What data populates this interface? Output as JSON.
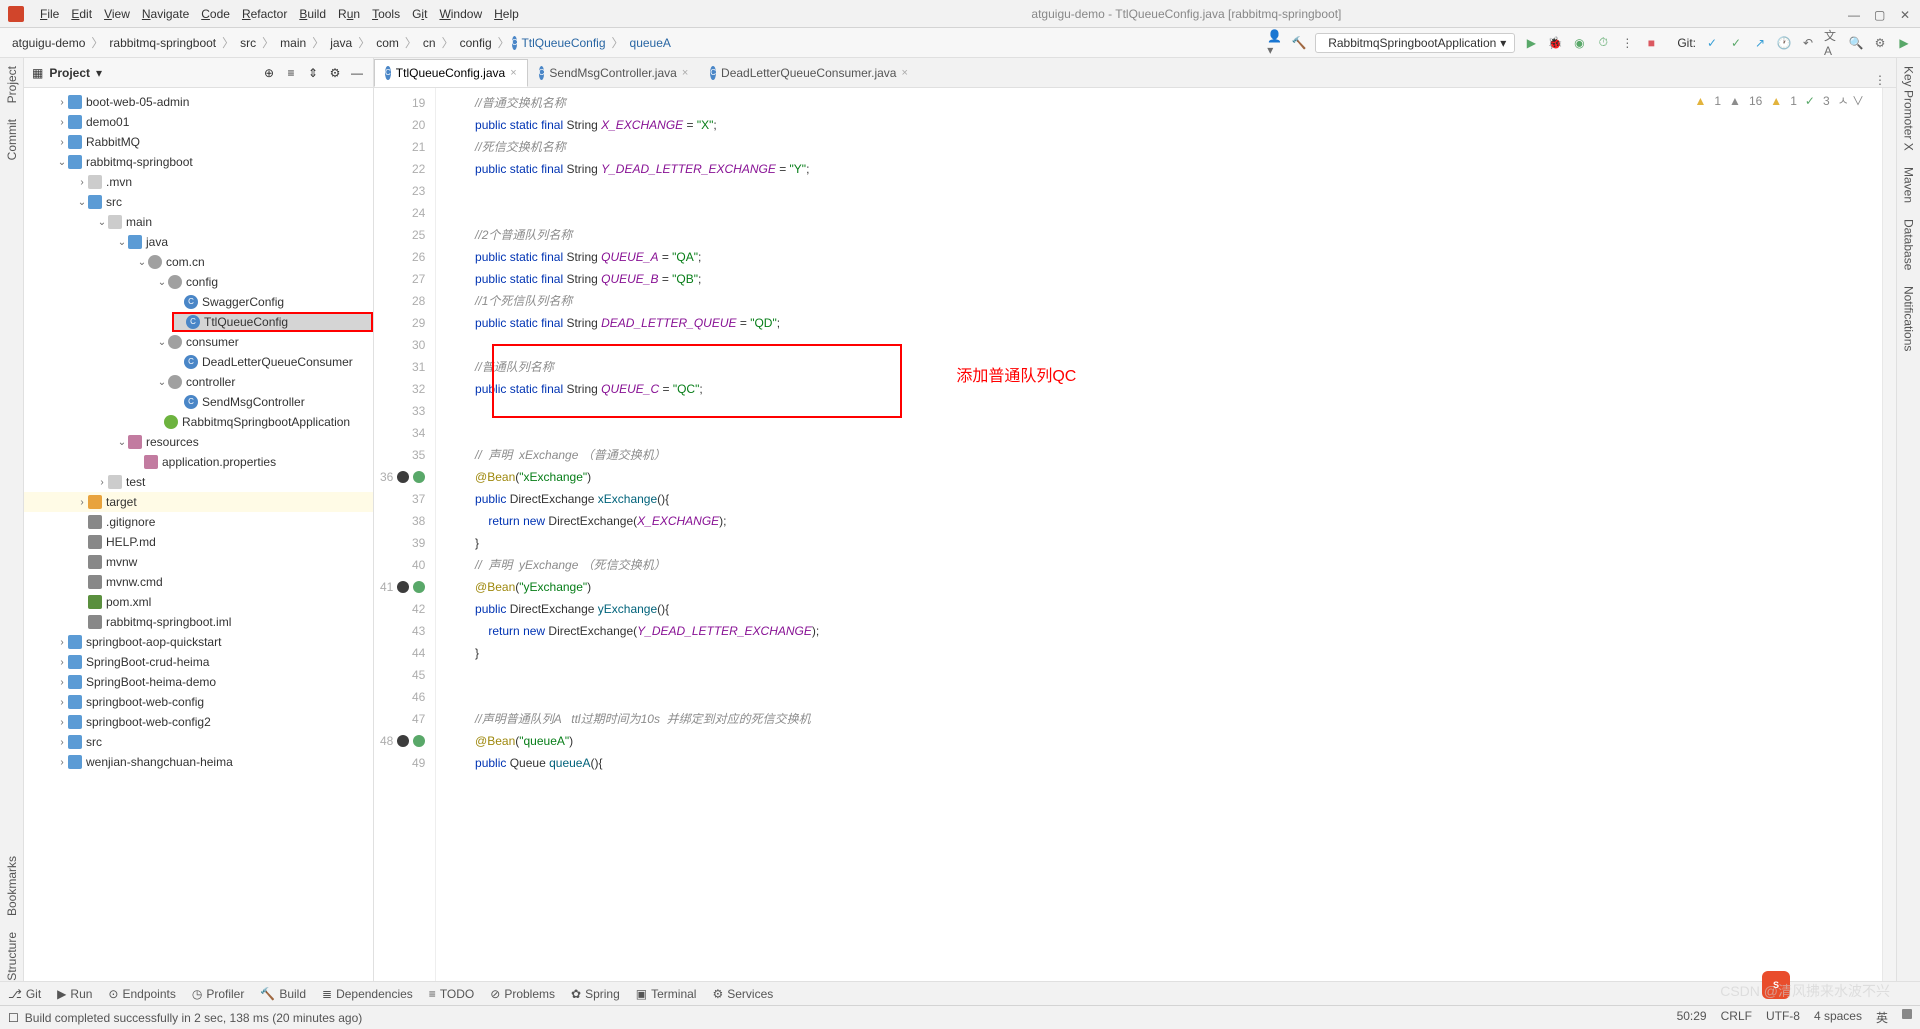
{
  "window": {
    "title": "atguigu-demo - TtlQueueConfig.java [rabbitmq-springboot]"
  },
  "menu": [
    "File",
    "Edit",
    "View",
    "Navigate",
    "Code",
    "Refactor",
    "Build",
    "Run",
    "Tools",
    "Git",
    "Window",
    "Help"
  ],
  "breadcrumbs": [
    "atguigu-demo",
    "rabbitmq-springboot",
    "src",
    "main",
    "java",
    "com",
    "cn",
    "config"
  ],
  "breadcrumb_class": "TtlQueueConfig",
  "breadcrumb_method": "queueA",
  "run_config": "RabbitmqSpringbootApplication",
  "git_label": "Git:",
  "project": {
    "title": "Project",
    "tree": {
      "boot": "boot-web-05-admin",
      "demo01": "demo01",
      "rabbitmq": "RabbitMQ",
      "rabbit_sb": "rabbitmq-springboot",
      "mvn": ".mvn",
      "src": "src",
      "main": "main",
      "java": "java",
      "pkg": "com.cn",
      "config": "config",
      "swagger": "SwaggerConfig",
      "ttl": "TtlQueueConfig",
      "consumer": "consumer",
      "dlqc": "DeadLetterQueueConsumer",
      "controller": "controller",
      "sendmsg": "SendMsgController",
      "app": "RabbitmqSpringbootApplication",
      "resources": "resources",
      "appprops": "application.properties",
      "test": "test",
      "target": "target",
      "gitignore": ".gitignore",
      "help": "HELP.md",
      "mvnw": "mvnw",
      "mvnwcmd": "mvnw.cmd",
      "pom": "pom.xml",
      "iml": "rabbitmq-springboot.iml",
      "aop": "springboot-aop-quickstart",
      "crud": "SpringBoot-crud-heima",
      "heima": "SpringBoot-heima-demo",
      "webconfig": "springboot-web-config",
      "webconfig2": "springboot-web-config2",
      "srcroot": "src",
      "wenjian": "wenjian-shangchuan-heima"
    }
  },
  "tabs": [
    {
      "label": "TtlQueueConfig.java",
      "active": true
    },
    {
      "label": "SendMsgController.java",
      "active": false
    },
    {
      "label": "DeadLetterQueueConsumer.java",
      "active": false
    }
  ],
  "warnings": {
    "w1": "1",
    "w2": "16",
    "w3": "1",
    "w4": "3"
  },
  "code": {
    "l19": "//普通交换机名称",
    "l20a": "X_EXCHANGE",
    "l20b": "\"X\"",
    "l21": "//死信交换机名称",
    "l22a": "Y_DEAD_LETTER_EXCHANGE",
    "l22b": "\"Y\"",
    "l25": "//2个普通队列名称",
    "l26a": "QUEUE_A",
    "l26b": "\"QA\"",
    "l27a": "QUEUE_B",
    "l27b": "\"QB\"",
    "l28": "//1个死信队列名称",
    "l29a": "DEAD_LETTER_QUEUE",
    "l29b": "\"QD\"",
    "l31": "//普通队列名称",
    "l32a": "QUEUE_C",
    "l32b": "\"QC\"",
    "l35": "//  声明  xExchange （普通交换机）",
    "l36": "\"xExchange\"",
    "l37": "xExchange",
    "l38": "X_EXCHANGE",
    "l40": "//  声明  yExchange （死信交换机）",
    "l41": "\"yExchange\"",
    "l42": "yExchange",
    "l43": "Y_DEAD_LETTER_EXCHANGE",
    "l47": "//声明普通队列A   ttl过期时间为10s  并绑定到对应的死信交换机",
    "l48": "\"queueA\"",
    "l49": "queueA"
  },
  "annotation": "添加普通队列QC",
  "bottom_tools": [
    "Git",
    "Run",
    "Endpoints",
    "Profiler",
    "Build",
    "Dependencies",
    "TODO",
    "Problems",
    "Spring",
    "Terminal",
    "Services"
  ],
  "status": {
    "msg": "Build completed successfully in 2 sec, 138 ms (20 minutes ago)",
    "pos": "50:29",
    "crlf": "CRLF",
    "enc": "UTF-8",
    "spaces": "4 spaces",
    "ime": "英"
  },
  "left_tools": [
    "Project",
    "Commit",
    "Bookmarks",
    "Structure"
  ],
  "right_tools": [
    "Key Promoter X",
    "Maven",
    "Database",
    "Notifications"
  ]
}
